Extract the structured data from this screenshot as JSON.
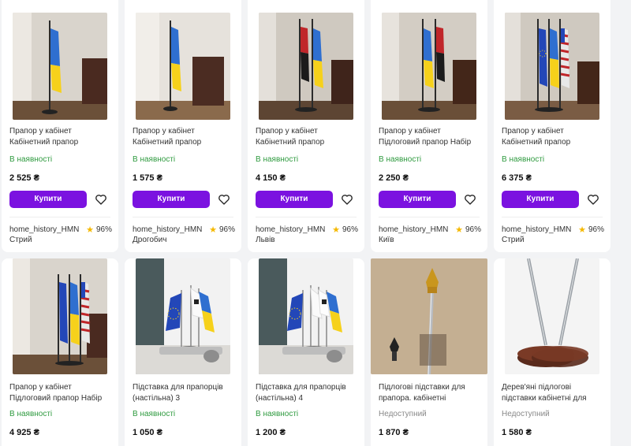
{
  "currency": "₴",
  "buy_label": "Купити",
  "products": [
    {
      "title": "Прапор у кабінет Кабінетний прапор Підлоговий прапор",
      "stock": "В наявності",
      "price": "2 525 ₴",
      "seller": "home_history_HMN",
      "city": "Стрий",
      "rating": "96%",
      "image": "ua-flag-single"
    },
    {
      "title": "Прапор у кабінет Кабінетний прапор Підлоговий прапор",
      "stock": "В наявності",
      "price": "1 575 ₴",
      "seller": "home_history_HMN",
      "city": "Дрогобич",
      "rating": "96%",
      "image": "ua-flag-single-chair"
    },
    {
      "title": "Прапор у кабінет Кабінетний прапор Підлоговий прапор",
      "stock": "В наявності",
      "price": "4 150 ₴",
      "seller": "home_history_HMN",
      "city": "Львів",
      "rating": "96%",
      "image": "red-black-and-ua-flags"
    },
    {
      "title": "Прапор у кабінет Підлоговий прапор Набір для двох пра-",
      "stock": "В наявності",
      "price": "2 250 ₴",
      "seller": "home_history_HMN",
      "city": "Київ",
      "rating": "96%",
      "image": "ua-and-red-black-flags"
    },
    {
      "title": "Прапор у кабінет Кабінетний прапор Підлоговий прапор",
      "stock": "В наявності",
      "price": "6 375 ₴",
      "seller": "home_history_HMN",
      "city": "Стрий",
      "rating": "96%",
      "image": "eu-ua-us-flags"
    },
    {
      "title": "Прапор у кабінет Підлоговий прапор Набір для трьох пра-",
      "stock": "В наявності",
      "price": "4 925 ₴",
      "image": "eu-ua-us-flags-room"
    },
    {
      "title": "Підставка для прапорців (настільна) 3",
      "stock": "В наявності",
      "price": "1 050 ₴",
      "image": "desk-flag-stand-3"
    },
    {
      "title": "Підставка для прапорців (настільна) 4",
      "stock": "В наявності",
      "price": "1 200 ₴",
      "image": "desk-flag-stand-4"
    },
    {
      "title": "Підлогові підставки для прапора. кабінетні флагштоки",
      "stock": "Недоступний",
      "price": "1 870 ₴",
      "image": "flagpole-finial"
    },
    {
      "title": "Дерев'яні підлогові підставки кабінетні для прапорів",
      "stock": "Недоступний",
      "price": "1 580 ₴",
      "image": "wooden-floor-stand"
    }
  ],
  "colors": {
    "accent": "#7b12e0",
    "in_stock": "#2e9a3f",
    "unavailable": "#888888",
    "star": "#f5b800"
  }
}
